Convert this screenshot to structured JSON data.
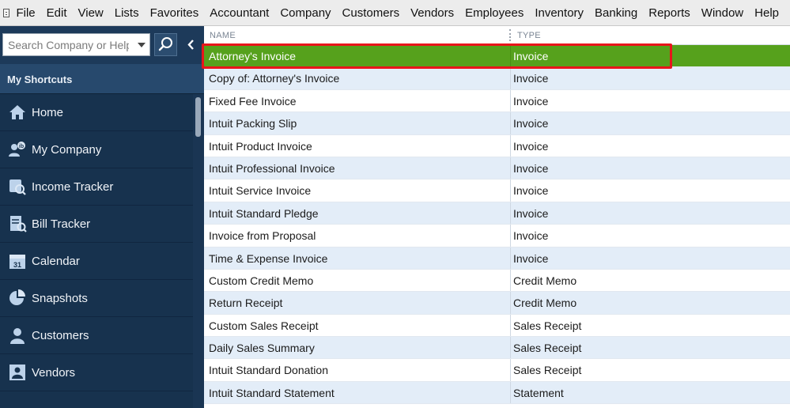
{
  "menu": {
    "items": [
      "File",
      "Edit",
      "View",
      "Lists",
      "Favorites",
      "Accountant",
      "Company",
      "Customers",
      "Vendors",
      "Employees",
      "Inventory",
      "Banking",
      "Reports",
      "Window",
      "Help"
    ]
  },
  "sidebar": {
    "search_placeholder": "Search Company or Help",
    "section_title": "My Shortcuts",
    "items": [
      {
        "label": "Home",
        "icon": "home-icon"
      },
      {
        "label": "My Company",
        "icon": "my-company-icon"
      },
      {
        "label": "Income Tracker",
        "icon": "income-tracker-icon"
      },
      {
        "label": "Bill Tracker",
        "icon": "bill-tracker-icon"
      },
      {
        "label": "Calendar",
        "icon": "calendar-icon"
      },
      {
        "label": "Snapshots",
        "icon": "snapshots-icon"
      },
      {
        "label": "Customers",
        "icon": "customers-icon"
      },
      {
        "label": "Vendors",
        "icon": "vendors-icon"
      }
    ],
    "calendar_day": "31"
  },
  "list": {
    "columns": {
      "name": "NAME",
      "type": "TYPE"
    },
    "selected_index": 0,
    "rows": [
      {
        "name": "Attorney's Invoice",
        "type": "Invoice"
      },
      {
        "name": "Copy of: Attorney's Invoice",
        "type": "Invoice"
      },
      {
        "name": "Fixed Fee Invoice",
        "type": "Invoice"
      },
      {
        "name": "Intuit Packing Slip",
        "type": "Invoice"
      },
      {
        "name": "Intuit Product Invoice",
        "type": "Invoice"
      },
      {
        "name": "Intuit Professional Invoice",
        "type": "Invoice"
      },
      {
        "name": "Intuit Service Invoice",
        "type": "Invoice"
      },
      {
        "name": "Intuit Standard Pledge",
        "type": "Invoice"
      },
      {
        "name": "Invoice from Proposal",
        "type": "Invoice"
      },
      {
        "name": "Time & Expense Invoice",
        "type": "Invoice"
      },
      {
        "name": "Custom Credit Memo",
        "type": "Credit Memo"
      },
      {
        "name": "Return Receipt",
        "type": "Credit Memo"
      },
      {
        "name": "Custom Sales Receipt",
        "type": "Sales Receipt"
      },
      {
        "name": "Daily Sales Summary",
        "type": "Sales Receipt"
      },
      {
        "name": "Intuit Standard Donation",
        "type": "Sales Receipt"
      },
      {
        "name": "Intuit Standard Statement",
        "type": "Statement"
      }
    ]
  },
  "colors": {
    "sidebar_bg": "#17324e",
    "selected_row": "#56a11c",
    "alt_row": "#e3edf8",
    "highlight_box": "#e8151b"
  }
}
